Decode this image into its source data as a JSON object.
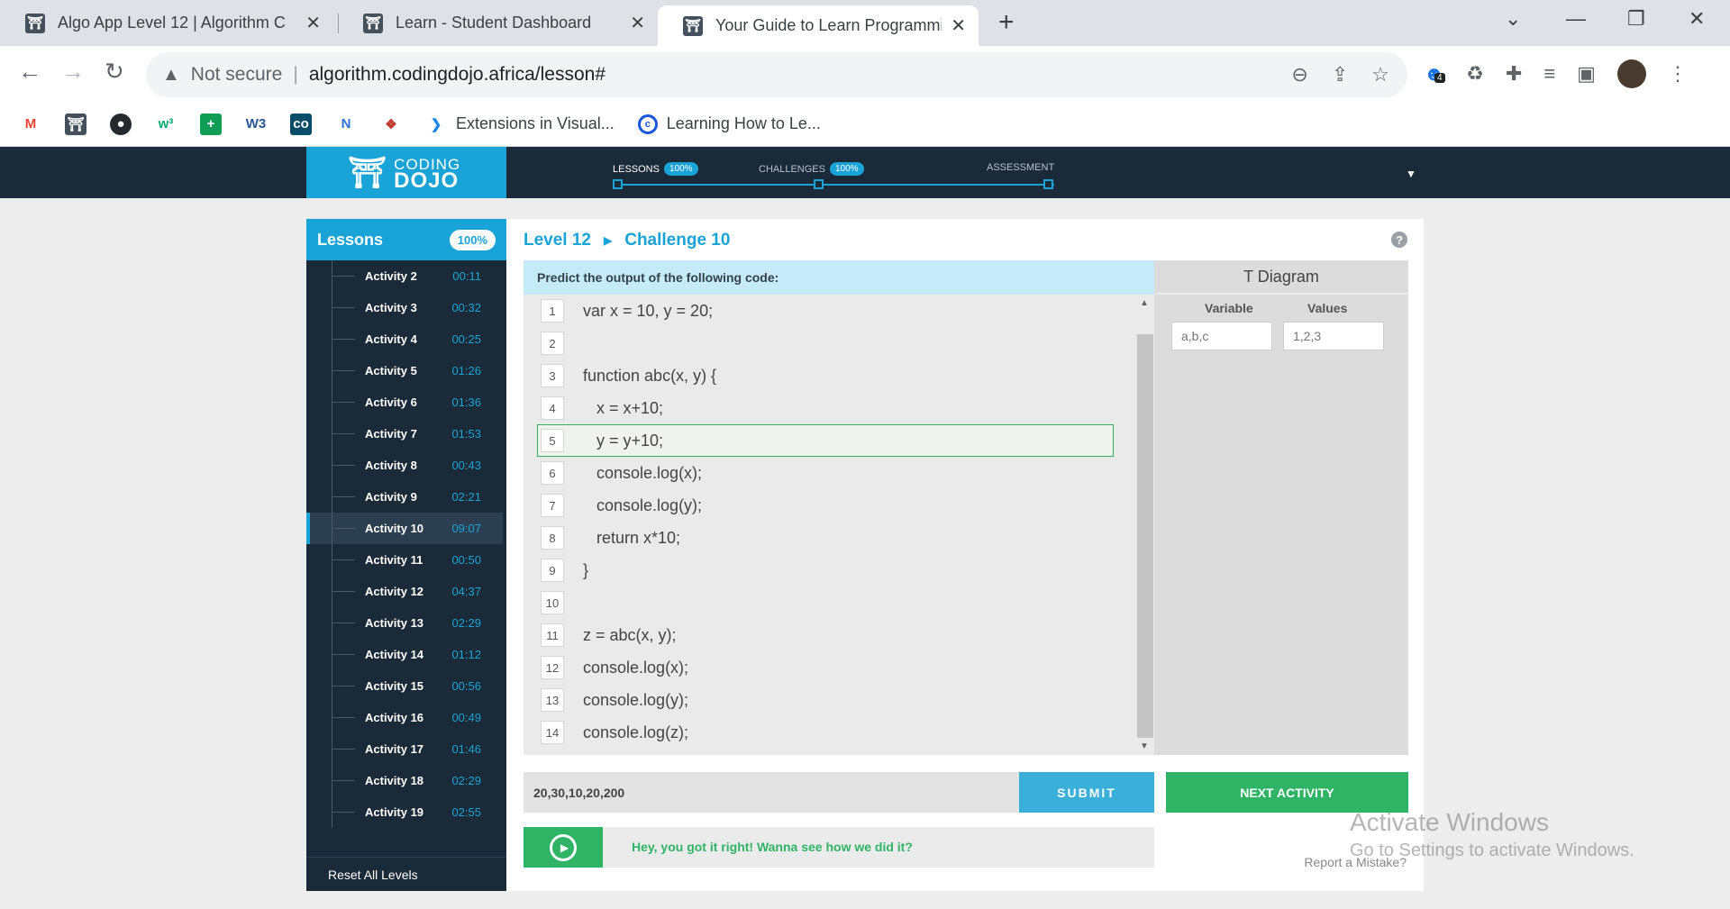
{
  "browser": {
    "tabs": [
      {
        "title": "Algo App Level 12 | Algorithm C",
        "active": false
      },
      {
        "title": "Learn - Student Dashboard",
        "active": false
      },
      {
        "title": "Your Guide to Learn Programmin",
        "active": true
      }
    ],
    "address": {
      "security": "Not secure",
      "url": "algorithm.codingdojo.africa/lesson#"
    },
    "extension_badge": "4",
    "bookmarks": [
      {
        "icon": "gmail-icon",
        "label": ""
      },
      {
        "icon": "codingdojo-icon",
        "label": ""
      },
      {
        "icon": "github-icon",
        "label": ""
      },
      {
        "icon": "w3schools-icon",
        "label": ""
      },
      {
        "icon": "plus-app-icon",
        "label": ""
      },
      {
        "icon": "w3-icon",
        "label": ""
      },
      {
        "icon": "codepen-icon",
        "label": ""
      },
      {
        "icon": "n-icon",
        "label": ""
      },
      {
        "icon": "diamond-icon",
        "label": ""
      },
      {
        "icon": "vscode-icon",
        "label": "Extensions in Visual..."
      },
      {
        "icon": "circle-c-icon",
        "label": "Learning How to Le..."
      }
    ]
  },
  "site": {
    "logo_top": "CODING",
    "logo_bottom": "DOJO",
    "progress": [
      {
        "label": "LESSONS",
        "badge": "100%"
      },
      {
        "label": "CHALLENGES",
        "badge": "100%"
      },
      {
        "label": "ASSESSMENT",
        "badge": ""
      }
    ]
  },
  "sidebar": {
    "title": "Lessons",
    "badge": "100%",
    "items": [
      {
        "label": "Activity 2",
        "time": "00:11"
      },
      {
        "label": "Activity 3",
        "time": "00:32"
      },
      {
        "label": "Activity 4",
        "time": "00:25"
      },
      {
        "label": "Activity 5",
        "time": "01:26"
      },
      {
        "label": "Activity 6",
        "time": "01:36"
      },
      {
        "label": "Activity 7",
        "time": "01:53"
      },
      {
        "label": "Activity 8",
        "time": "00:43"
      },
      {
        "label": "Activity 9",
        "time": "02:21"
      },
      {
        "label": "Activity 10",
        "time": "09:07"
      },
      {
        "label": "Activity 11",
        "time": "00:50"
      },
      {
        "label": "Activity 12",
        "time": "04:37"
      },
      {
        "label": "Activity 13",
        "time": "02:29"
      },
      {
        "label": "Activity 14",
        "time": "01:12"
      },
      {
        "label": "Activity 15",
        "time": "00:56"
      },
      {
        "label": "Activity 16",
        "time": "00:49"
      },
      {
        "label": "Activity 17",
        "time": "01:46"
      },
      {
        "label": "Activity 18",
        "time": "02:29"
      },
      {
        "label": "Activity 19",
        "time": "02:55"
      }
    ],
    "active_index": 8,
    "reset_label": "Reset All Levels"
  },
  "main": {
    "level": "Level 12",
    "challenge": "Challenge 10",
    "prompt": "Predict the output of the following code:",
    "highlighted_line": 5,
    "code": [
      {
        "n": "1",
        "text": "var x = 10, y = 20;"
      },
      {
        "n": "2",
        "text": ""
      },
      {
        "n": "3",
        "text": "function abc(x, y) {"
      },
      {
        "n": "4",
        "text": "   x = x+10;"
      },
      {
        "n": "5",
        "text": "   y = y+10;"
      },
      {
        "n": "6",
        "text": "   console.log(x);"
      },
      {
        "n": "7",
        "text": "   console.log(y);"
      },
      {
        "n": "8",
        "text": "   return x*10;"
      },
      {
        "n": "9",
        "text": "}"
      },
      {
        "n": "10",
        "text": ""
      },
      {
        "n": "11",
        "text": "z = abc(x, y);"
      },
      {
        "n": "12",
        "text": "console.log(x);"
      },
      {
        "n": "13",
        "text": "console.log(y);"
      },
      {
        "n": "14",
        "text": "console.log(z);"
      }
    ],
    "t_diagram": {
      "title": "T Diagram",
      "col_variable": "Variable",
      "col_values": "Values",
      "variable_value": "a,b,c",
      "values_value": "1,2,3"
    },
    "answer_value": "20,30,10,20,200",
    "submit_label": "SUBMIT",
    "next_label": "NEXT ACTIVITY",
    "result_message": "Hey, you got it right! Wanna see how we did it?",
    "report_label": "Report a Mistake?"
  },
  "watermark": {
    "line1": "Activate Windows",
    "line2": "Go to Settings to activate Windows."
  },
  "colors": {
    "brand_blue": "#1aa3d6",
    "dark_navy": "#1b2a38",
    "success_green": "#2fb465"
  }
}
